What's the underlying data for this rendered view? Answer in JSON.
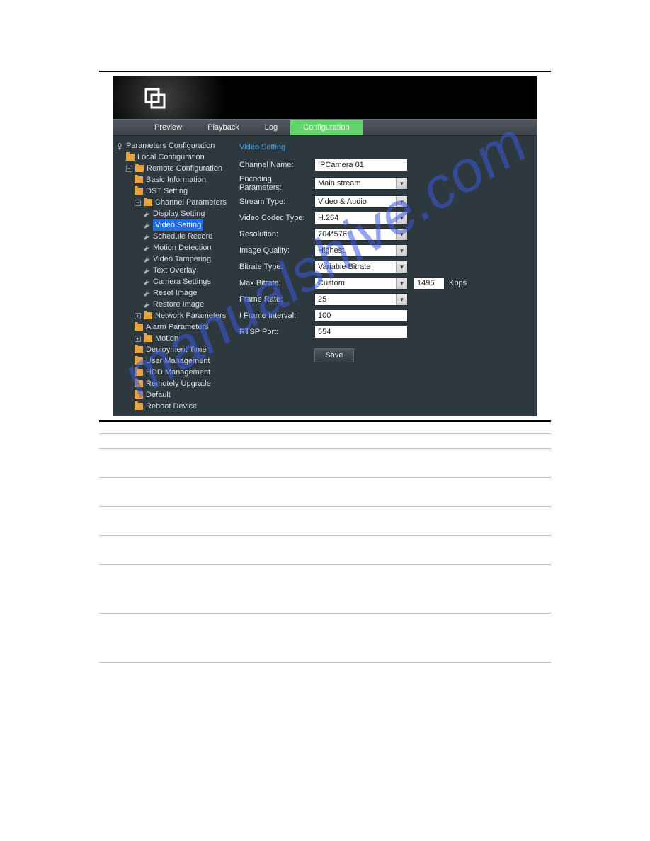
{
  "watermark": "manualshive.com",
  "tabs": {
    "preview": "Preview",
    "playback": "Playback",
    "log": "Log",
    "configuration": "Configuration"
  },
  "sidebar": {
    "root": "Parameters Configuration",
    "local_config": "Local Configuration",
    "remote_config": "Remote Configuration",
    "basic_info": "Basic Information",
    "dst_setting": "DST Setting",
    "channel_params": "Channel Parameters",
    "display_setting": "Display Setting",
    "video_setting": "Video Setting",
    "schedule_record": "Schedule Record",
    "motion_detection": "Motion Detection",
    "video_tampering": "Video Tampering",
    "text_overlay": "Text Overlay",
    "camera_settings": "Camera Settings",
    "reset_image": "Reset Image",
    "restore_image": "Restore Image",
    "network_params": "Network Parameters",
    "alarm_params": "Alarm Parameters",
    "motion": "Motion",
    "deployment_time": "Deployment Time",
    "user_mgmt": "User Management",
    "hdd_mgmt": "HDD Management",
    "remotely_upgrade": "Remotely Upgrade",
    "default": "Default",
    "reboot": "Reboot Device"
  },
  "form": {
    "title": "Video Setting",
    "labels": {
      "channel_name": "Channel Name:",
      "encoding_params": "Encoding Parameters:",
      "stream_type": "Stream Type:",
      "video_codec": "Video Codec Type:",
      "resolution": "Resolution:",
      "image_quality": "Image Quality:",
      "bitrate_type": "Bitrate Type:",
      "max_bitrate": "Max Bitrate:",
      "frame_rate": "Frame Rate:",
      "i_frame": "I Frame Interval:",
      "rtsp_port": "RTSP Port:"
    },
    "values": {
      "channel_name": "IPCamera 01",
      "encoding_params": "Main stream",
      "stream_type": "Video & Audio",
      "video_codec": "H.264",
      "resolution": "704*576",
      "image_quality": "Highest",
      "bitrate_type": "Variable Bitrate",
      "max_bitrate": "Custom",
      "max_bitrate_custom": "1496",
      "max_bitrate_unit": "Kbps",
      "frame_rate": "25",
      "i_frame": "100",
      "rtsp_port": "554"
    },
    "save": "Save"
  }
}
